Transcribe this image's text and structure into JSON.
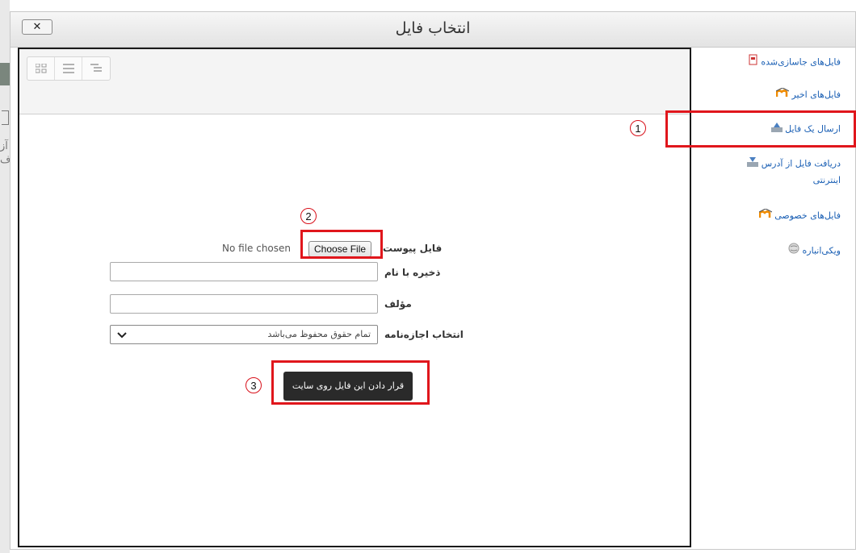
{
  "dialog": {
    "title": "انتخاب فایل",
    "close_label": "✕"
  },
  "background": {
    "fragment_1": "آز",
    "fragment_2": "یاف"
  },
  "sidebar": {
    "items": [
      {
        "label": "فایل‌های جاسازی‌شده",
        "icon": "embedded-files-icon"
      },
      {
        "label": "فایل‌های اخیر",
        "icon": "moodle-recent-icon"
      },
      {
        "label": "ارسال یک فایل",
        "icon": "upload-icon"
      },
      {
        "label": "دریافت فایل از آدرس",
        "label_cont": "اینترنتی",
        "icon": "download-url-icon"
      },
      {
        "label": "فایل‌های خصوصی",
        "icon": "moodle-private-icon"
      },
      {
        "label": "ویکی‌انباره",
        "icon": "wikimedia-icon"
      }
    ]
  },
  "toolbar": {
    "views": [
      "icons-view",
      "list-view",
      "tree-view"
    ]
  },
  "form": {
    "attachment_label": "فایل پیوست",
    "choose_file": "Choose File",
    "no_file": "No file chosen",
    "save_as_label": "ذخیره با نام",
    "save_as_value": "",
    "author_label": "مؤلف",
    "author_value": "",
    "license_label": "انتخاب اجازه‌نامه",
    "license_value": "تمام حقوق محفوظ می‌باشد",
    "submit_label": "قرار دادن این فایل روی سایت"
  },
  "annotations": [
    "1",
    "2",
    "3"
  ],
  "colors": {
    "highlight": "#e0161c",
    "link": "#1a5fb4",
    "submit_bg": "#2a2a2a"
  }
}
